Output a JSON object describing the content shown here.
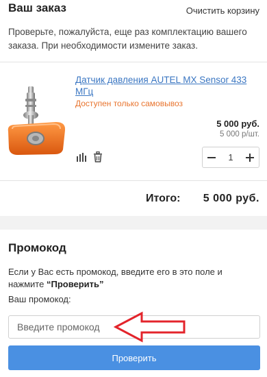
{
  "order": {
    "title": "Ваш заказ",
    "clear_cart_label": "Очистить корзину",
    "description": "Проверьте, пожалуйста, еще раз комплектацию вашего заказа. При необходимости измените заказ."
  },
  "cart_items": [
    {
      "name": "Датчик давления AUTEL MX Sensor 433 МГц",
      "availability_note": "Доступен только самовывоз",
      "price": "5 000 руб.",
      "unit_price": "5 000 р/шт.",
      "quantity": "1",
      "icons": [
        "bar-chart-icon",
        "trash-icon"
      ]
    }
  ],
  "totals": {
    "label": "Итого:",
    "value": "5 000 руб."
  },
  "promo": {
    "title": "Промокод",
    "description_prefix": "Если у Вас есть промокод, введите его в это поле и нажмите ",
    "description_emphasis": "“Проверить”",
    "label": "Ваш промокод:",
    "input_placeholder": "Введите промокод",
    "input_value": "",
    "check_button_label": "Проверить"
  },
  "colors": {
    "link": "#3a76c2",
    "pickup_note": "#e8742e",
    "button": "#4a90e2",
    "arrow": "#e3242b",
    "band": "#f2f2f2"
  }
}
